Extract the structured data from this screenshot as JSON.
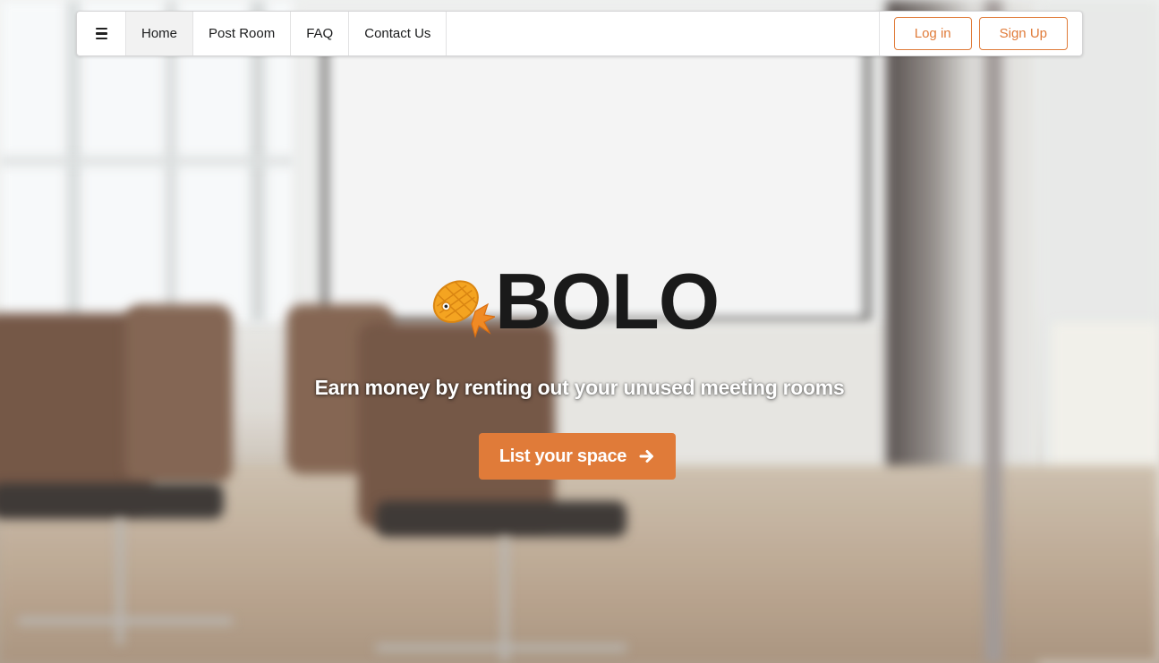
{
  "nav": {
    "menu_icon": "hamburger-menu-icon",
    "items": [
      {
        "label": "Home",
        "active": true
      },
      {
        "label": "Post Room",
        "active": false
      },
      {
        "label": "FAQ",
        "active": false
      },
      {
        "label": "Contact Us",
        "active": false
      }
    ],
    "login_label": "Log in",
    "signup_label": "Sign Up"
  },
  "hero": {
    "logo_icon": "pineapple-fish-logo-icon",
    "brand": "BOLO",
    "tagline": "Earn money by renting out your unused meeting rooms",
    "cta_label": "List your space",
    "cta_icon": "arrow-right-icon"
  },
  "colors": {
    "accent": "#e07b39",
    "text_dark": "#1a1a1a",
    "nav_background": "#ffffff"
  }
}
